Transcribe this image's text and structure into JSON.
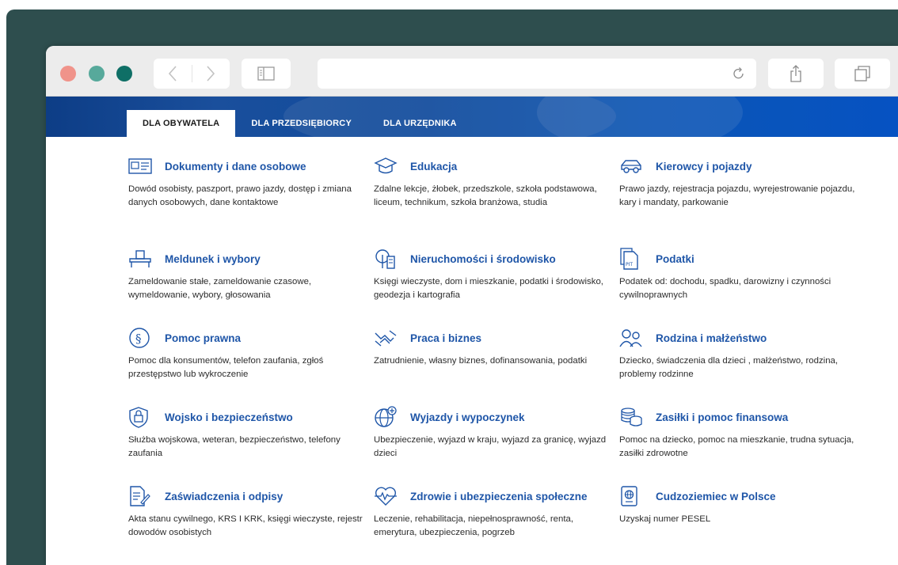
{
  "tabs": [
    {
      "label": "DLA OBYWATELA",
      "active": true
    },
    {
      "label": "DLA PRZEDSIĘBIORCY",
      "active": false
    },
    {
      "label": "DLA URZĘDNIKA",
      "active": false
    }
  ],
  "colors": {
    "accent": "#1f56a8",
    "hero": "#0b56b5",
    "backdrop": "#2e4e4e"
  },
  "categories": [
    {
      "title": "Dokumenty i dane osobowe",
      "desc": "Dowód osobisty, paszport, prawo jazdy, dostęp i zmiana danych osobowych, dane kontaktowe",
      "icon": "id-card-icon"
    },
    {
      "title": "Edukacja",
      "desc": "Zdalne lekcje, żłobek, przedszkole, szkoła podstawowa, liceum, technikum, szkoła branżowa, studia",
      "icon": "graduation-cap-icon"
    },
    {
      "title": "Kierowcy i pojazdy",
      "desc": "Prawo jazdy, rejestracja pojazdu, wyrejestrowanie pojazdu, kary i mandaty, parkowanie",
      "icon": "car-icon"
    },
    {
      "title": "Meldunek i wybory",
      "desc": "Zameldowanie stałe, zameldowanie czasowe, wymeldowanie, wybory, głosowania",
      "icon": "ballot-box-icon"
    },
    {
      "title": "Nieruchomości i środowisko",
      "desc": "Księgi wieczyste, dom i mieszkanie, podatki i środowisko, geodezja i kartografia",
      "icon": "tree-building-icon"
    },
    {
      "title": "Podatki",
      "desc": "Podatek od: dochodu, spadku, darowizny i czynności cywilnoprawnych",
      "icon": "tax-document-icon"
    },
    {
      "title": "Pomoc prawna",
      "desc": "Pomoc dla konsumentów, telefon zaufania, zgłoś przestępstwo lub wykroczenie",
      "icon": "paragraph-icon"
    },
    {
      "title": "Praca i biznes",
      "desc": "Zatrudnienie, własny biznes, dofinansowania, podatki",
      "icon": "handshake-icon"
    },
    {
      "title": "Rodzina i małżeństwo",
      "desc": "Dziecko, świadczenia dla dzieci , małżeństwo, rodzina, problemy rodzinne",
      "icon": "family-icon"
    },
    {
      "title": "Wojsko i bezpieczeństwo",
      "desc": "Służba wojskowa, weteran, bezpieczeństwo, telefony zaufania",
      "icon": "shield-lock-icon"
    },
    {
      "title": "Wyjazdy i wypoczynek",
      "desc": "Ubezpieczenie, wyjazd w kraju, wyjazd za granicę, wyjazd dzieci",
      "icon": "globe-plane-icon"
    },
    {
      "title": "Zasiłki i pomoc finansowa",
      "desc": "Pomoc na dziecko, pomoc na mieszkanie, trudna sytuacja, zasiłki zdrowotne",
      "icon": "coins-icon"
    },
    {
      "title": "Zaświadczenia i odpisy",
      "desc": "Akta stanu cywilnego, KRS I KRK, księgi wieczyste, rejestr dowodów osobistych",
      "icon": "document-pen-icon"
    },
    {
      "title": "Zdrowie i ubezpieczenia społeczne",
      "desc": "Leczenie, rehabilitacja, niepełnosprawność, renta, emerytura, ubezpieczenia, pogrzeb",
      "icon": "heart-pulse-icon"
    },
    {
      "title": "Cudzoziemiec w Polsce",
      "desc": "Uzyskaj numer PESEL",
      "icon": "passport-icon"
    }
  ]
}
